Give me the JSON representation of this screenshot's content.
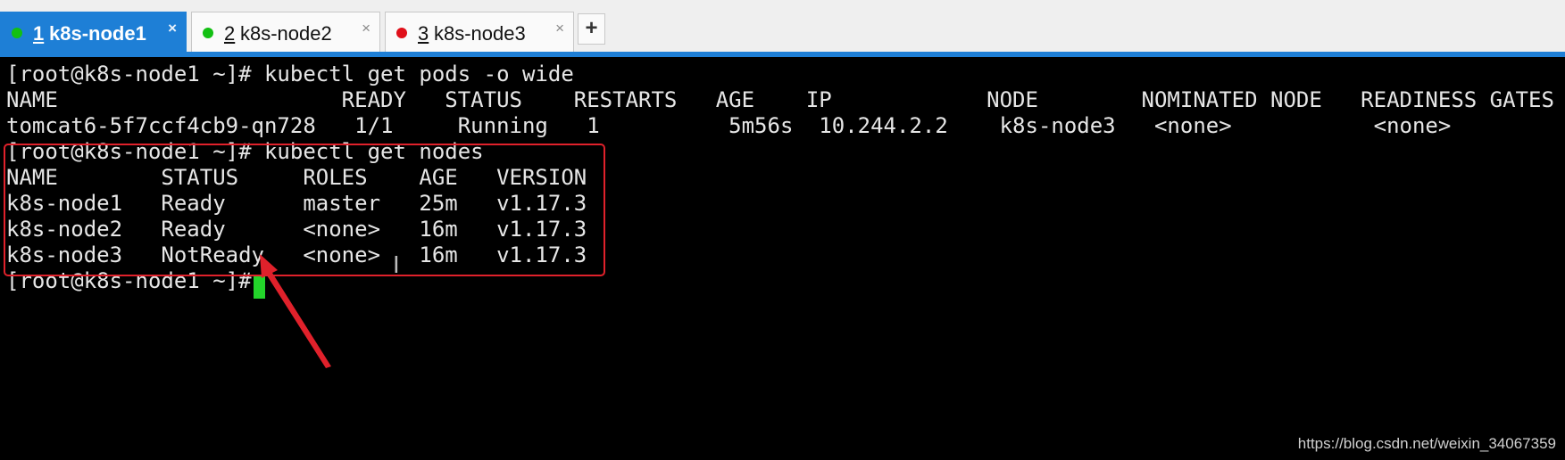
{
  "tabs": [
    {
      "number": "1",
      "title": "k8s-node1",
      "active": true,
      "dot_color": "#13c013",
      "close": "×"
    },
    {
      "number": "2",
      "title": "k8s-node2",
      "active": false,
      "dot_color": "#13c013",
      "close": "×"
    },
    {
      "number": "3",
      "title": "k8s-node3",
      "active": false,
      "dot_color": "#e0101a",
      "close": "×"
    }
  ],
  "new_tab_label": "+",
  "terminal": {
    "lines": [
      "[root@k8s-node1 ~]# kubectl get pods -o wide",
      "NAME                      READY   STATUS    RESTARTS   AGE    IP            NODE        NOMINATED NODE   READINESS GATES",
      "tomcat6-5f7ccf4cb9-qn728   1/1     Running   1          5m56s  10.244.2.2    k8s-node3   <none>           <none>",
      "[root@k8s-node1 ~]# kubectl get nodes",
      "NAME        STATUS     ROLES    AGE   VERSION",
      "k8s-node1   Ready      master   25m   v1.17.3",
      "k8s-node2   Ready      <none>   16m   v1.17.3",
      "k8s-node3   NotReady   <none>   16m   v1.17.3",
      "[root@k8s-node1 ~]# "
    ],
    "cursor_color": "#23d42a",
    "highlight_color": "#e0212b"
  },
  "watermark": "https://blog.csdn.net/weixin_34067359"
}
